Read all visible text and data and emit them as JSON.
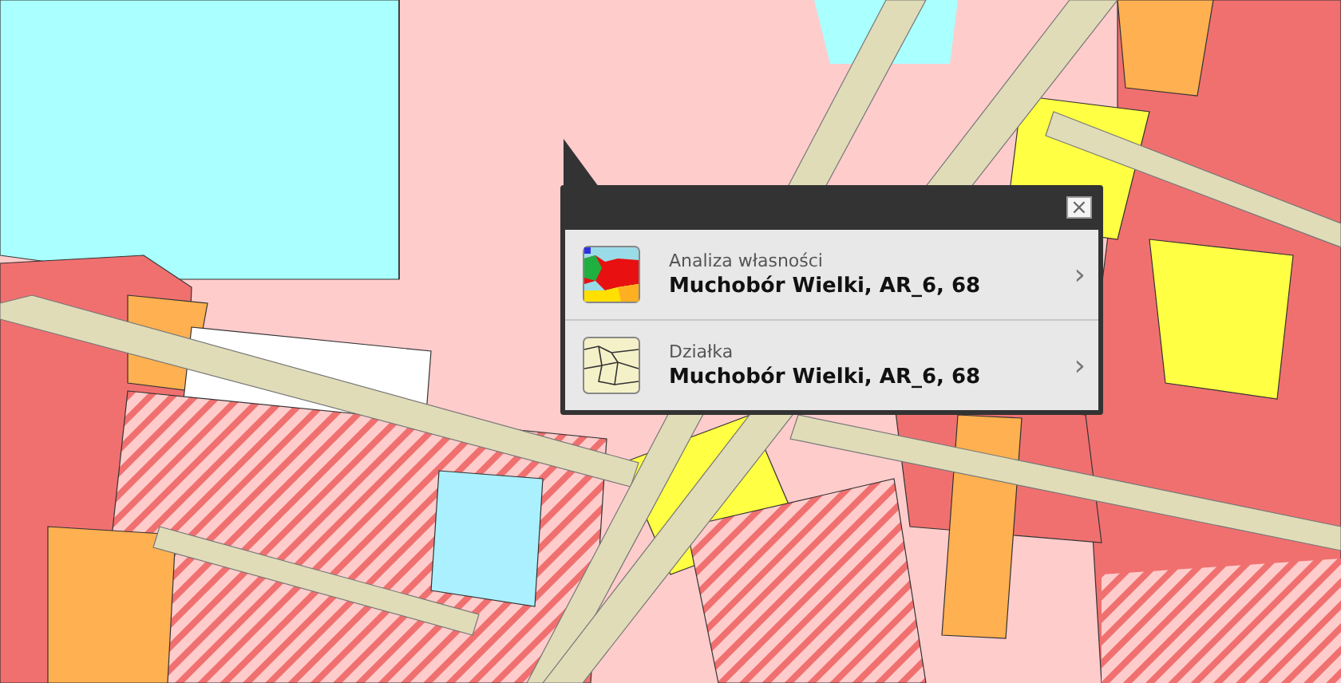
{
  "popup": {
    "close": "×",
    "items": [
      {
        "kind": "ownership",
        "title": "Analiza własności",
        "subtitle": "Muchobór Wielki, AR_6, 68",
        "chevron": "›"
      },
      {
        "kind": "parcel",
        "title": "Działka",
        "subtitle": "Muchobór Wielki, AR_6, 68",
        "chevron": "›"
      }
    ]
  }
}
